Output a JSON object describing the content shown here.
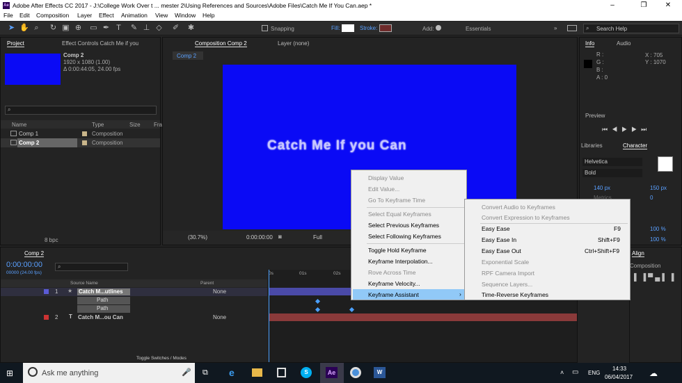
{
  "window": {
    "title": "Adobe After Effects CC 2017 - J:\\College Work Over t ... mester 2\\Using References and Sources\\Adobe Files\\Catch Me If You Can.aep *",
    "logo": "Ae"
  },
  "menubar": [
    "File",
    "Edit",
    "Composition",
    "Layer",
    "Effect",
    "Animation",
    "View",
    "Window",
    "Help"
  ],
  "toolbar": {
    "snapping": "Snapping",
    "fill": "Fill:",
    "stroke": "Stroke:",
    "add": "Add:",
    "workspace": "Essentials",
    "search_placeholder": "Search Help"
  },
  "project": {
    "tab": "Project",
    "tab2": "Effect Controls Catch Me if you",
    "comp_name": "Comp 2",
    "comp_size": "1920 x 1080 (1.00)",
    "comp_dur": "Δ 0:00:44:05, 24.00 fps",
    "thumb_color": "#0a0af5",
    "col_name": "Name",
    "col_type": "Type",
    "col_size": "Size",
    "col_fr": "Fra",
    "items": [
      {
        "name": "Comp 1",
        "type": "Composition"
      },
      {
        "name": "Comp 2",
        "type": "Composition"
      }
    ],
    "bpc": "8 bpc"
  },
  "comp": {
    "tab": "Composition Comp 2",
    "layer_tab": "Layer (none)",
    "sub_tab": "Comp 2",
    "title_text": "Catch Me If you Can",
    "zoom": "(30.7%)",
    "time": "0:00:00:00",
    "res": "Full"
  },
  "info": {
    "tab": "Info",
    "tab2": "Audio",
    "r": "R :",
    "g": "G :",
    "b": "B :",
    "a": "A : 0",
    "x": "X : 705",
    "y": "Y : 1070",
    "preview": "Preview",
    "libraries": "Libraries",
    "character": "Character",
    "font": "Helvetica",
    "style": "Bold",
    "size": "140 px",
    "leading": "150 px",
    "tracking": "0",
    "metrics": "Metrics",
    "scale": "100 %",
    "scale2": "100 %",
    "align": "Align",
    "composition": "Composition"
  },
  "timeline": {
    "tab": "Comp 2",
    "time": "0:00:00:00",
    "fps": "00000 (24.00 fps)",
    "source_name": "Source Name",
    "parent": "Parent",
    "ruler": [
      "0s",
      "01s",
      "02s"
    ],
    "toggle": "Toggle Switches / Modes",
    "layers": [
      {
        "num": "1",
        "name": "Catch M...utlines",
        "parent": "None",
        "color": "#5b5bd6"
      },
      {
        "num": "2",
        "name": "Catch M...ou Can",
        "parent": "None",
        "color": "#c33"
      }
    ],
    "paths": [
      "Path",
      "Path"
    ]
  },
  "context_menu": {
    "items": [
      {
        "label": "Display Value",
        "disabled": true
      },
      {
        "label": "Edit Value...",
        "disabled": true
      },
      {
        "label": "Go To Keyframe Time",
        "disabled": true
      },
      {
        "label": "Select Equal Keyframes",
        "disabled": true
      },
      {
        "label": "Select Previous Keyframes",
        "disabled": false
      },
      {
        "label": "Select Following Keyframes",
        "disabled": false
      },
      {
        "label": "Toggle Hold Keyframe",
        "disabled": false
      },
      {
        "label": "Keyframe Interpolation...",
        "disabled": false
      },
      {
        "label": "Rove Across Time",
        "disabled": true
      },
      {
        "label": "Keyframe Velocity...",
        "disabled": false
      },
      {
        "label": "Keyframe Assistant",
        "disabled": false
      }
    ]
  },
  "submenu": {
    "items": [
      {
        "label": "Convert Audio to Keyframes",
        "shortcut": "",
        "disabled": true
      },
      {
        "label": "Convert Expression to Keyframes",
        "shortcut": "",
        "disabled": true
      },
      {
        "label": "Easy Ease",
        "shortcut": "F9",
        "disabled": false
      },
      {
        "label": "Easy Ease In",
        "shortcut": "Shift+F9",
        "disabled": false
      },
      {
        "label": "Easy Ease Out",
        "shortcut": "Ctrl+Shift+F9",
        "disabled": false
      },
      {
        "label": "Exponential Scale",
        "shortcut": "",
        "disabled": true
      },
      {
        "label": "RPF Camera Import",
        "shortcut": "",
        "disabled": true
      },
      {
        "label": "Sequence Layers...",
        "shortcut": "",
        "disabled": true
      },
      {
        "label": "Time-Reverse Keyframes",
        "shortcut": "",
        "disabled": false
      }
    ]
  },
  "taskbar": {
    "search": "Ask me anything",
    "time": "14:33",
    "date": "06/04/2017",
    "lang": "ENG"
  }
}
